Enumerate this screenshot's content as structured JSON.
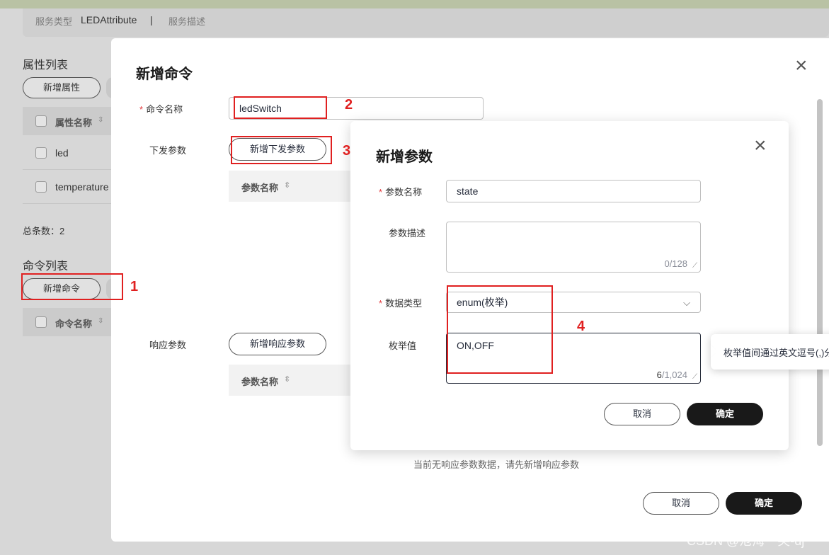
{
  "background": {
    "service_type_label": "服务类型",
    "service_type_value": "LEDAttribute",
    "separator": "|",
    "service_desc_label": "服务描述",
    "property_list_title": "属性列表",
    "add_property_button": "新增属性",
    "property_table": {
      "header": "属性名称",
      "rows": [
        "led",
        "temperature"
      ]
    },
    "total_count": "总条数：2",
    "command_list_title": "命令列表",
    "add_command_button": "新增命令",
    "command_table_header": "命令名称"
  },
  "add_command_dialog": {
    "title": "新增命令",
    "command_name_label": "命令名称",
    "command_name_value": "ledSwitch",
    "send_params_label": "下发参数",
    "add_send_param_button": "新增下发参数",
    "send_params_table_header": "参数名称",
    "response_params_label": "响应参数",
    "add_response_param_button": "新增响应参数",
    "response_params_table_header": "参数名称",
    "empty_response_tip": "当前无响应参数数据，请先新增响应参数",
    "cancel_button": "取消",
    "confirm_button": "确定"
  },
  "add_param_dialog": {
    "title": "新增参数",
    "param_name_label": "参数名称",
    "param_name_value": "state",
    "param_desc_label": "参数描述",
    "param_desc_value": "",
    "param_desc_counter_current": "0",
    "param_desc_counter_max": "/128",
    "data_type_label": "数据类型",
    "data_type_value": "enum(枚举)",
    "enum_label": "枚举值",
    "enum_value": "ON,OFF",
    "enum_counter_current": "6",
    "enum_counter_max": "/1,024",
    "cancel_button": "取消",
    "confirm_button": "确定"
  },
  "tooltip": {
    "text": "枚举值间通过英文逗号(,)分隔"
  },
  "annotations": {
    "markers": [
      "1",
      "2",
      "3",
      "4"
    ],
    "color": "#e02020"
  },
  "watermark": "CSDN @沧海一笑-dj",
  "icons": {
    "close": "close-icon",
    "sort": "sort-icon",
    "dropdown": "chevron-down-icon",
    "resize": "resize-handle-icon"
  }
}
